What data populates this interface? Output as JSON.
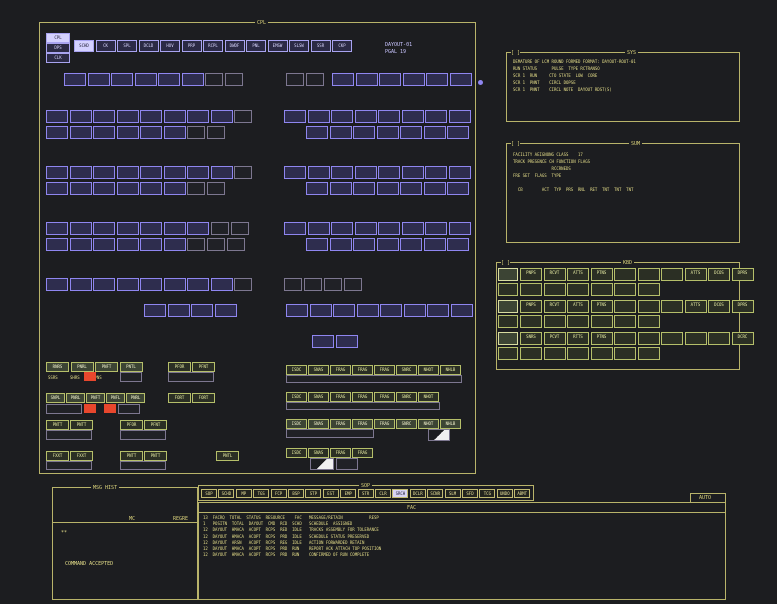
{
  "cpl": {
    "title": "CPL",
    "mode_labels": [
      "CPL",
      "DPS",
      "CLK"
    ],
    "tabs": [
      "SCHD",
      "CK",
      "SPL",
      "DCLD",
      "HOV",
      "PRP",
      "RCPL",
      "DWDF",
      "PNL",
      "EMSW",
      "SLSW",
      "SSR",
      "CKP"
    ],
    "selected_tab": "SCHD",
    "info_lines": [
      "DAYOUT-01",
      "PGAL 19"
    ],
    "sel_a": [
      "RNRS",
      "PNRL",
      "PNFT",
      "PNTL"
    ],
    "sel_a_sub": [
      "SSRS",
      "SHRS",
      "PPNS"
    ],
    "sel_b": [
      "SNPL",
      "PNRL",
      "PNFT",
      "PNFL",
      "PNRL"
    ],
    "pair_labels": [
      "FORT",
      "FORT",
      "PNTT",
      "PNTT"
    ],
    "bottom_labels": [
      "FXXT",
      "FXXT",
      "PNTT",
      "PNTT",
      "PNTL",
      "PNTT",
      "FNLM"
    ],
    "misc_labels": [
      "PFOR",
      "PFNT"
    ],
    "right_labels": [
      "ISDC",
      "SNAS",
      "FRAG",
      "FRAG",
      "FRAG",
      "SNRC",
      "NHOT",
      "NHLB"
    ]
  },
  "alm": {
    "title": "SYS",
    "lines": [
      "DEMATURE OF LCM ROUND FORMED FORMAT: DAYOUT-ROUT-01",
      "RUN STATUS      PULSE  TYPE RCTRANSO",
      "SCR 1  RUN     CTO STATE  LOW  CORE",
      "SCR 1  PNNT    CIRCL DOPSE",
      "SCR 1  PNNT    CIRCL NOTE  DAYOUT RDST(S)"
    ]
  },
  "sum": {
    "title": "SUM",
    "lines": [
      "FACILITY AEIGNONG CLASS    17",
      "TRACK PRESENCE CH FUNCTION FLAGS",
      "                RCCRNEDS",
      "FRE SET  FLAGS  TYPE",
      "",
      "  CB        ACT  TYP  PRS  RNL  RET  TNT  TNT  TNT"
    ]
  },
  "kbd": {
    "title": "KBD",
    "rows": [
      [
        "PNPS",
        "RCVT",
        "ATTS",
        "PTNS",
        "",
        "",
        "",
        "ATTS",
        "DCOS",
        "DPRS"
      ],
      [
        "PNPS",
        "RCVT",
        "ATTS",
        "PTNS",
        "",
        "",
        "",
        "ATTS",
        "DCOS",
        "DPRS"
      ],
      [
        "SNRS",
        "PCVT",
        "RTTS",
        "PTNS",
        "",
        "",
        "",
        "",
        "",
        "DCRC"
      ]
    ]
  },
  "msg": {
    "title": "MSG  HIST",
    "subtitle": "MC",
    "side": "REGRE",
    "prompt": "**",
    "status": "COMMAND ACCEPTED"
  },
  "sop": {
    "title": "SOP",
    "tabs": [
      "SOP",
      "SCHD",
      "MP",
      "TGS",
      "FCP",
      "BSP",
      "STP",
      "EST",
      "EMP",
      "STR",
      "CLR",
      "SRCH",
      "DCLR",
      "SCNR",
      "SLM",
      "SFD",
      "TCG",
      "UNDO",
      "ABMT"
    ],
    "selected_tab": "SRCH",
    "auto_label": "AUTO",
    "col_label": "FAC",
    "lines": [
      "13  FACRQ  TOTAL  STATUS  RESOURCE    FAC   MESSAGE/RETAIN           RESP",
      "1   POSITN  TOTAL  DAYOUT  CMD  RCD  SCHD   SCHEDULE  ASSIGNED",
      "12  DAYOUT  HMACA  ACOPT  RCPS  RED  IDLE   TRACKS ASSEMBLY FOR TOLERANCE",
      "12  DAYOUT  HMACA  ACOPT  RCPS  PRD  IDLE   SCHEDULE STATUS PRESERVED",
      "12  DAYOUT  ARSN   ACOPT  RCPS  REG  IDLE   ACTION FORWARDED RETAIN",
      "12  DAYOUT  HMACA  ACOPT  RCPS  PRD  RUN    REPORT ACK ATTACH TOP POSITION",
      "12  DAYOUT  HMACA  ACOPT  RCPS  PRD  RUN    CONFIRMED OF RUN COMPLETE"
    ]
  },
  "colors": {
    "background": "#1c1d20",
    "frame": "#b8b36a",
    "violet": "#8f86f0",
    "yellow": "#e6df8a",
    "alert": "#e8472d"
  }
}
